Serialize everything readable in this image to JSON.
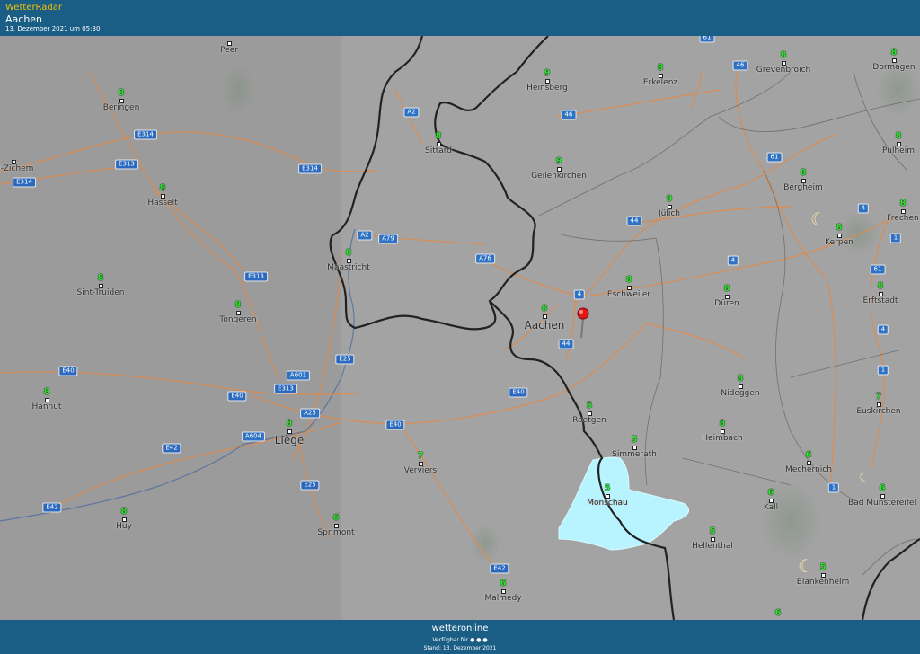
{
  "header": {
    "app_name": "WetterRadar",
    "location": "Aachen",
    "timestamp": "13. Dezember 2021 um 05:30"
  },
  "footer": {
    "brand": "wetteronline",
    "available": "Verfügbar für",
    "stand": "Stand: 13. Dezember 2021"
  },
  "map": {
    "cities": [
      {
        "name": "Peer",
        "temp": ""
      },
      {
        "name": "Beringen",
        "temp": "8"
      },
      {
        "name": "el-Zichem",
        "temp": ""
      },
      {
        "name": "Hasselt",
        "temp": "8"
      },
      {
        "name": "Sint-Truiden",
        "temp": "8"
      },
      {
        "name": "Tongeren",
        "temp": "8"
      },
      {
        "name": "Hannut",
        "temp": "8"
      },
      {
        "name": "Huy",
        "temp": "8"
      },
      {
        "name": "Liège",
        "temp": "8"
      },
      {
        "name": "Sprimont",
        "temp": "6"
      },
      {
        "name": "Verviers",
        "temp": "7"
      },
      {
        "name": "Malmedy",
        "temp": "6"
      },
      {
        "name": "Maastricht",
        "temp": "8"
      },
      {
        "name": "Sittard",
        "temp": "8"
      },
      {
        "name": "Heinsberg",
        "temp": "9"
      },
      {
        "name": "Geilenkirchen",
        "temp": "9"
      },
      {
        "name": "Erkelenz",
        "temp": "8"
      },
      {
        "name": "Grevenbroich",
        "temp": "8"
      },
      {
        "name": "Dormagen",
        "temp": "8"
      },
      {
        "name": "Pulheim",
        "temp": "8"
      },
      {
        "name": "Bergheim",
        "temp": "8"
      },
      {
        "name": "Frechen",
        "temp": "8"
      },
      {
        "name": "Kerpen",
        "temp": "8"
      },
      {
        "name": "Erftstadt",
        "temp": "8"
      },
      {
        "name": "Jülich",
        "temp": "9"
      },
      {
        "name": "Aachen",
        "temp": "8"
      },
      {
        "name": "Eschweiler",
        "temp": "8"
      },
      {
        "name": "Düren",
        "temp": "8"
      },
      {
        "name": "Nideggen",
        "temp": "8"
      },
      {
        "name": "Roetgen",
        "temp": "5"
      },
      {
        "name": "Simmerath",
        "temp": "5"
      },
      {
        "name": "Heimbach",
        "temp": "8"
      },
      {
        "name": "Monschau",
        "temp": "5"
      },
      {
        "name": "Hellenthal",
        "temp": "5"
      },
      {
        "name": "Mechernich",
        "temp": "6"
      },
      {
        "name": "Euskirchen",
        "temp": "7"
      },
      {
        "name": "Kall",
        "temp": "6"
      },
      {
        "name": "Bad Münstereifel",
        "temp": "6"
      },
      {
        "name": "Blankenheim",
        "temp": "5"
      }
    ],
    "roads": [
      "E314",
      "E314",
      "E313",
      "E314",
      "A2",
      "A2",
      "A79",
      "A76",
      "E313",
      "E25",
      "A601",
      "E313",
      "E40",
      "E40",
      "A25",
      "E40",
      "E40",
      "A604",
      "E42",
      "E42",
      "E25",
      "E42",
      "46",
      "61",
      "46",
      "61",
      "4",
      "4",
      "44",
      "4",
      "44",
      "4",
      "1",
      "61",
      "1",
      "1"
    ],
    "extra_temp": "6"
  },
  "colors": {
    "header_bg": "#1a5d85",
    "accent": "#f2c200",
    "temp": "#2ee62e",
    "precip": "#b8f4ff",
    "road": "#e08a4a",
    "border": "#222222"
  }
}
